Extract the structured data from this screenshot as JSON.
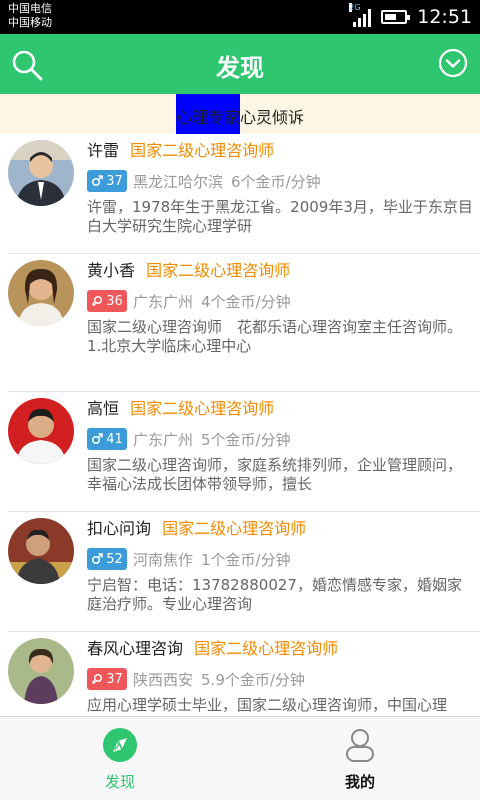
{
  "status_bar": {
    "carrier_1": "中国电信",
    "carrier_2": "中国移动",
    "network_type": "2G",
    "time": "12:51",
    "battery_level": 0.6
  },
  "header": {
    "title": "发现",
    "left_icon": "search-icon",
    "right_icon": "chevron-down-circle-icon",
    "color": "#2ec66e"
  },
  "banner": {
    "text": "心理专家心灵倾诉",
    "highlight_color": "#0000ff"
  },
  "counselors": [
    {
      "name": "许雷",
      "title": "国家二级心理咨询师",
      "gender": "male",
      "gender_icon": "male-icon",
      "age": "37",
      "location": "黑龙江哈尔滨",
      "price": "6个金币/分钟",
      "description": "许雷，1978年生于黑龙江省。2009年3月，毕业于东京目白大学研究生院心理学研"
    },
    {
      "name": "黄小香",
      "title": "国家二级心理咨询师",
      "gender": "female",
      "gender_icon": "female-icon",
      "age": "36",
      "location": "广东广州",
      "price": "4个金币/分钟",
      "description": "国家二级心理咨询师　花都乐语心理咨询室主任咨询师。\n1.北京大学临床心理中心"
    },
    {
      "name": "高恒",
      "title": "国家二级心理咨询师",
      "gender": "male",
      "gender_icon": "male-icon",
      "age": "41",
      "location": "广东广州",
      "price": "5个金币/分钟",
      "description": "国家二级心理咨询师，家庭系统排列师，企业管理顾问，幸福心法成长团体带领导师，擅长"
    },
    {
      "name": "扣心问询",
      "title": "国家二级心理咨询师",
      "gender": "male",
      "gender_icon": "male-icon",
      "age": "52",
      "location": "河南焦作",
      "price": "1个金币/分钟",
      "description": "宁启智：电话：13782880027，婚恋情感专家，婚姻家庭治疗师。专业心理咨询"
    },
    {
      "name": "春风心理咨询",
      "title": "国家二级心理咨询师",
      "gender": "female",
      "gender_icon": "female-icon",
      "age": "37",
      "location": "陕西西安",
      "price": "5.9个金币/分钟",
      "description": "应用心理学硕士毕业，国家二级心理咨询师，中国心理"
    }
  ],
  "tab_bar": {
    "tabs": [
      {
        "label": "发现",
        "icon": "compass-icon",
        "active": true
      },
      {
        "label": "我的",
        "icon": "user-icon",
        "active": false
      }
    ],
    "active_color": "#2ec66e"
  }
}
